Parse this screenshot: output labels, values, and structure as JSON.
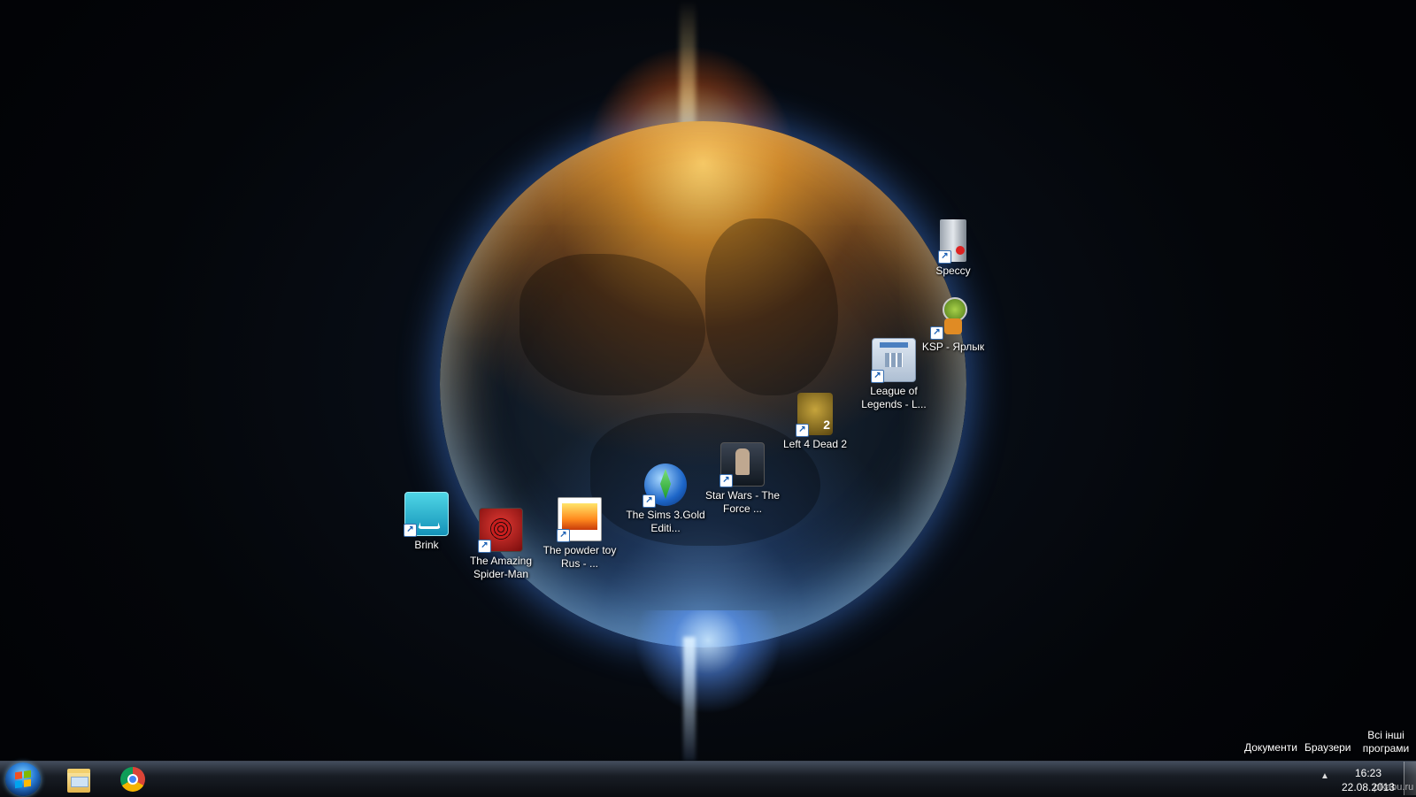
{
  "desktop": {
    "icons": [
      {
        "label": "Speccy",
        "icon": "speccy-icon"
      },
      {
        "label": "KSP - Ярлык",
        "icon": "ksp-icon"
      },
      {
        "label": "League of Legends - L...",
        "icon": "league-of-legends-icon"
      },
      {
        "label": "Left 4 Dead 2",
        "icon": "left-4-dead-2-icon"
      },
      {
        "label": "Star Wars - The Force ...",
        "icon": "star-wars-icon"
      },
      {
        "label": "The Sims 3.Gold Editi...",
        "icon": "sims-icon"
      },
      {
        "label": "The powder toy Rus - ...",
        "icon": "powder-toy-icon"
      },
      {
        "label": "The Amazing Spider-Man",
        "icon": "spider-man-icon"
      },
      {
        "label": "Brink",
        "icon": "brink-icon"
      }
    ]
  },
  "deskbands": {
    "documents": "Документи",
    "browsers": "Браузери",
    "all_programs": "Всі інші програми"
  },
  "taskbar": {
    "pinned": [
      {
        "name": "windows-explorer",
        "icon": "folder-icon"
      },
      {
        "name": "google-chrome",
        "icon": "chrome-icon"
      }
    ],
    "tray_arrow": "▲",
    "clock": {
      "time": "16:23",
      "date": "22.08.2013"
    }
  },
  "watermark": "pikabu.ru",
  "colors": {
    "taskbar": "#14181f",
    "start_orb": "#2577d1",
    "planet_glow": "#4a8cff",
    "sun_flare": "#ffb040"
  }
}
